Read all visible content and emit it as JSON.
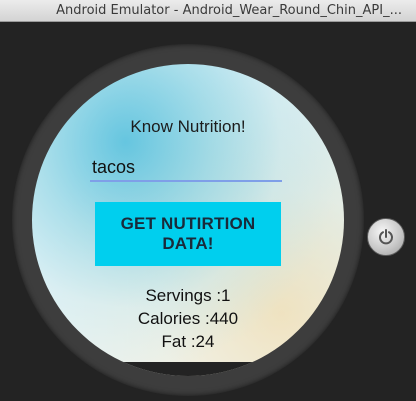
{
  "window": {
    "title": "Android Emulator - Android_Wear_Round_Chin_API_..."
  },
  "app": {
    "title": "Know Nutrition!",
    "search": {
      "value": "tacos",
      "placeholder": ""
    },
    "button_label": "GET NUTIRTION DATA!",
    "results": {
      "servings": "Servings :1",
      "calories": "Calories :440",
      "fat": "Fat :24"
    }
  },
  "icons": {
    "power": "power-icon"
  },
  "colors": {
    "button": "#00cfee",
    "input_underline": "#7f9fe8",
    "bezel": "#3d3d3d",
    "background": "#262626"
  }
}
